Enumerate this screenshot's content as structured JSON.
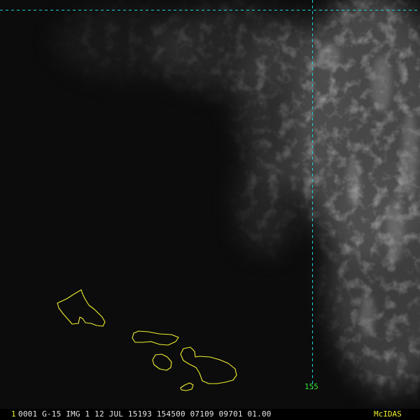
{
  "image": {
    "frame_index": "1",
    "status_text": "0001 G-15 IMG     1 12 JUL 15193 154500 07109 09701 01.00",
    "brand": "McIDAS",
    "longitude_label": "155"
  },
  "colors": {
    "background": "#0c0c0c",
    "clouds": "#8a8a8a",
    "grid_lines": "#1fd3d8",
    "coastline": "#f0f030",
    "longitude_label": "#33e033",
    "status_text": "#e8e8e8",
    "frame_index": "#f0f030",
    "brand": "#f0f030"
  },
  "icons": {
    "coastline_outlines": "hawaiian-islands-coastline-icon"
  }
}
